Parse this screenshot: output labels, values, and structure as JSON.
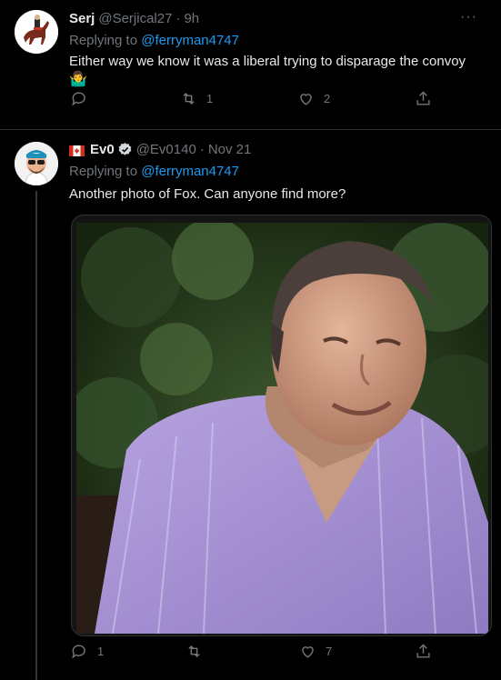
{
  "tweets": [
    {
      "name": "Serj",
      "handle": "@Serjical27",
      "separator": "·",
      "time": "9h",
      "replying_prefix": "Replying to",
      "replying_to": "@ferryman4747",
      "text": "Either way we know it was a liberal trying to disparage the convoy",
      "emoji": "🤷‍♂️",
      "more": "···",
      "actions": {
        "reply": "",
        "retweet": "1",
        "like": "2",
        "share": ""
      }
    },
    {
      "flag": "canada-flag-icon",
      "name": "Ev0",
      "handle": "@Ev0140",
      "separator": "·",
      "time": "Nov 21",
      "replying_prefix": "Replying to",
      "replying_to": "@ferryman4747",
      "text": "Another photo of Fox. Can anyone find more?",
      "more": "···",
      "actions": {
        "reply": "1",
        "retweet": "",
        "like": "7",
        "share": ""
      }
    }
  ],
  "colors": {
    "background": "#000000",
    "text": "#e7e9ea",
    "muted": "#71767b",
    "link": "#1d9bf0",
    "divider": "#2f3336"
  }
}
